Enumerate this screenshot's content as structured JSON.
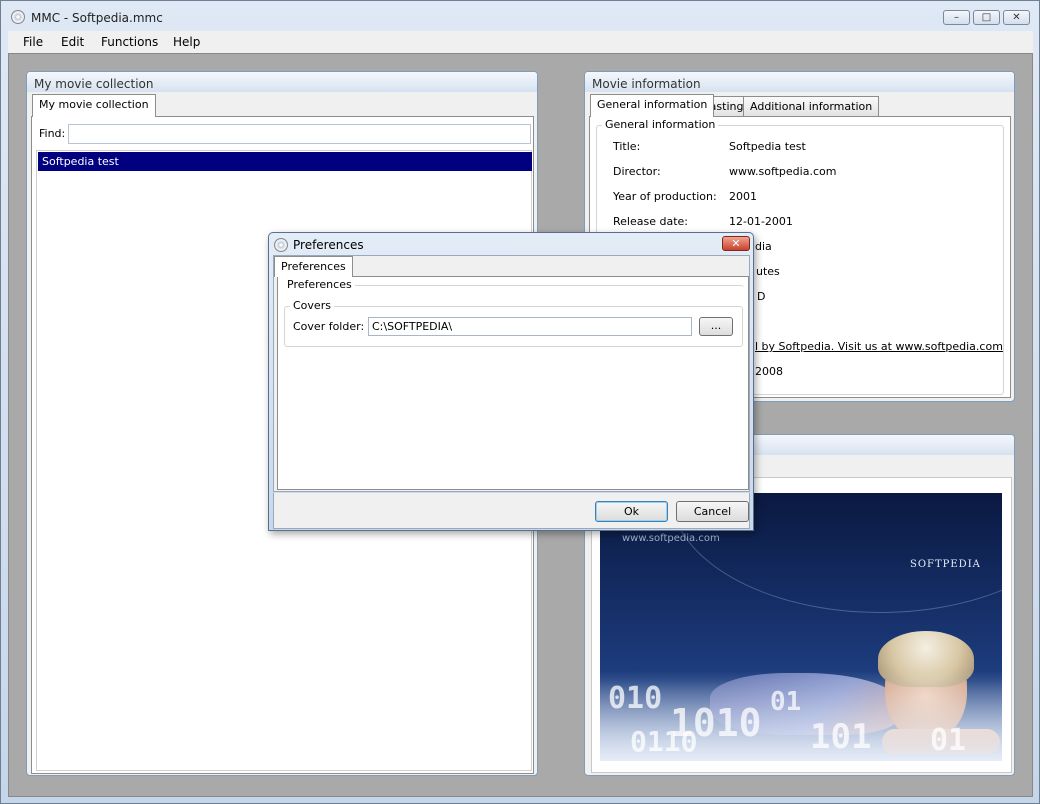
{
  "window": {
    "title": "MMC - Softpedia.mmc",
    "minimize": "–",
    "maximize": "□",
    "close": "✕"
  },
  "menu": [
    "File",
    "Edit",
    "Functions",
    "Help"
  ],
  "collection": {
    "panel_title": "My movie collection",
    "tab": "My movie collection",
    "find_label": "Find:",
    "find_value": "",
    "items": [
      "Softpedia test"
    ]
  },
  "movie_info": {
    "panel_title": "Movie information",
    "tabs": [
      "General information",
      "Casting",
      "Additional information"
    ],
    "group_title": "General information",
    "fields": [
      {
        "label": "Title:",
        "value": "Softpedia test"
      },
      {
        "label": "Director:",
        "value": "www.softpedia.com"
      },
      {
        "label": "Year of production:",
        "value": "2001"
      },
      {
        "label": "Release date:",
        "value": "12-01-2001"
      },
      {
        "label": "",
        "value": "dia"
      },
      {
        "label": "",
        "value": "utes"
      },
      {
        "label": "",
        "value": "D"
      },
      {
        "label": "",
        "value": ""
      },
      {
        "label": "",
        "value": "l by Softpedia. Visit us at www.softpedia.com"
      },
      {
        "label": "",
        "value": "2008"
      }
    ]
  },
  "cover_panel": {
    "poster_brand": "SOFTPEDIA",
    "poster_url": "www.softpedia.com"
  },
  "dialog": {
    "title": "Preferences",
    "close": "✕",
    "tab": "Preferences",
    "group_title": "Preferences",
    "covers_title": "Covers",
    "cover_folder_label": "Cover folder:",
    "cover_folder_value": "C:\\SOFTPEDIA\\",
    "browse_label": "...",
    "ok_label": "Ok",
    "cancel_label": "Cancel"
  }
}
